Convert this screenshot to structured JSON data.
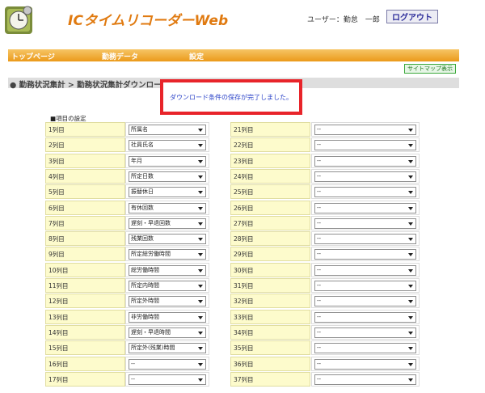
{
  "app": {
    "title": "ICタイムリコーダーWeb"
  },
  "header": {
    "user_label": "ユーザー：勤怠　一郎",
    "logout_label": "ログアウト"
  },
  "nav": {
    "items": [
      "トップページ",
      "勤務データ",
      "設定"
    ]
  },
  "sitemap_label": "サイトマップ表示",
  "breadcrumb": "● 勤務状況集計 > 勤務状況集計ダウンロード設定",
  "notice": "ダウンロード条件の保存が完了しました。",
  "section_title": "■項目の設定",
  "columns": {
    "left": [
      {
        "label": "1列目",
        "value": "所属名"
      },
      {
        "label": "2列目",
        "value": "社員氏名"
      },
      {
        "label": "3列目",
        "value": "年月"
      },
      {
        "label": "4列目",
        "value": "所定日数"
      },
      {
        "label": "5列目",
        "value": "振替休日"
      },
      {
        "label": "6列目",
        "value": "有休回数"
      },
      {
        "label": "7列目",
        "value": "遅刻・早退回数"
      },
      {
        "label": "8列目",
        "value": "残業回数"
      },
      {
        "label": "9列目",
        "value": "所定総労働時間"
      },
      {
        "label": "10列目",
        "value": "総労働時間"
      },
      {
        "label": "11列目",
        "value": "所定内時間"
      },
      {
        "label": "12列目",
        "value": "所定外時間"
      },
      {
        "label": "13列目",
        "value": "非労働時間"
      },
      {
        "label": "14列目",
        "value": "遅刻・早退時間"
      },
      {
        "label": "15列目",
        "value": "所定外(残業)時間"
      },
      {
        "label": "16列目",
        "value": "--"
      },
      {
        "label": "17列目",
        "value": "--"
      }
    ],
    "right": [
      {
        "label": "21列目",
        "value": "--"
      },
      {
        "label": "22列目",
        "value": "--"
      },
      {
        "label": "23列目",
        "value": "--"
      },
      {
        "label": "24列目",
        "value": "--"
      },
      {
        "label": "25列目",
        "value": "--"
      },
      {
        "label": "26列目",
        "value": "--"
      },
      {
        "label": "27列目",
        "value": "--"
      },
      {
        "label": "28列目",
        "value": "--"
      },
      {
        "label": "29列目",
        "value": "--"
      },
      {
        "label": "30列目",
        "value": "--"
      },
      {
        "label": "31列目",
        "value": "--"
      },
      {
        "label": "32列目",
        "value": "--"
      },
      {
        "label": "33列目",
        "value": "--"
      },
      {
        "label": "34列目",
        "value": "--"
      },
      {
        "label": "35列目",
        "value": "--"
      },
      {
        "label": "36列目",
        "value": "--"
      },
      {
        "label": "37列目",
        "value": "--"
      }
    ]
  },
  "colors": {
    "accent": "#eb9a1a",
    "title": "#e07a10",
    "notice_border": "#e8242a",
    "label_bg": "#fdfbcc"
  },
  "icons": {
    "logo": "clock-icon"
  }
}
